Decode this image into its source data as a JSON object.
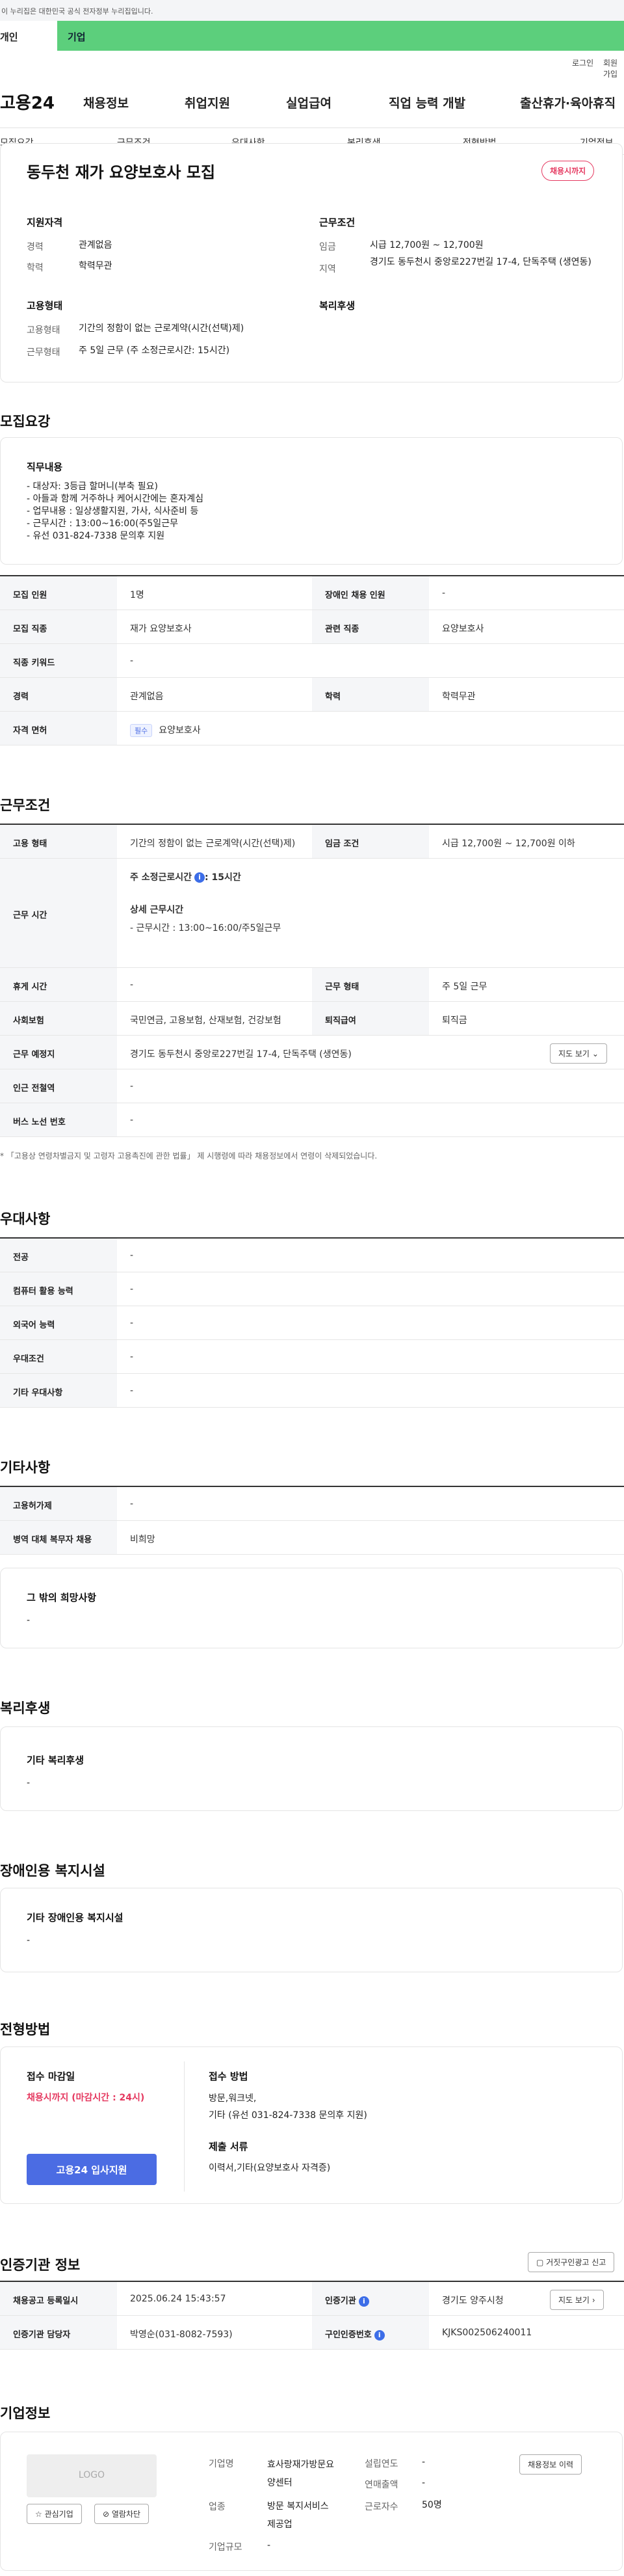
{
  "gov_notice": "이 누리집은 대한민국 공식 전자정부 누리집입니다.",
  "tabs": {
    "person": "개인",
    "company": "기업"
  },
  "util": {
    "login": "로그인",
    "join": "회원가입"
  },
  "gnb": {
    "logo": "고용24",
    "items": [
      "채용정보",
      "취업지원",
      "실업급여",
      "직업 능력 개발",
      "출산휴가·육아휴직"
    ]
  },
  "subnav": [
    "모집요강",
    "근무조건",
    "우대사항",
    "복리후생",
    "전형방법",
    "기업정보"
  ],
  "summary": {
    "title": "동두천 재가 요양보호사 모집",
    "badge": "채용시까지",
    "qual_heading": "지원자격",
    "career_label": "경력",
    "career_value": "관계없음",
    "edu_label": "학력",
    "edu_value": "학력무관",
    "work_heading": "근무조건",
    "wage_label": "임금",
    "wage_value": "시급 12,700원 ~ 12,700원",
    "region_label": "지역",
    "region_value": "경기도 동두천시 중앙로227번길 17-4, 단독주택 (생연동)",
    "emp_heading": "고용형태",
    "emp_type_label": "고용형태",
    "emp_type_value": "기간의 정함이 없는 근로계약(시간(선택)제)",
    "emp_form_label": "근무형태",
    "emp_form_value": "주 5일 근무 (주 소정근로시간: 15시간)",
    "welfare_heading": "복리후생"
  },
  "recruit": {
    "section_title": "모집요강",
    "duty_heading": "직무내용",
    "duty_text": "- 대상자: 3등급 할머니(부축 필요)\n- 아들과 함께 거주하나 케어시간에는 혼자계심\n- 업무내용 : 일상생활지원, 가사, 식사준비 등\n- 근무시간 : 13:00~16:00(주5일근무\n- 유선 031-824-7338 문의후 지원",
    "rows": [
      {
        "l1": "모집 인원",
        "v1": "1명",
        "l2": "장애인 채용 인원",
        "v2": "-"
      },
      {
        "l1": "모집 직종",
        "v1": "재가 요양보호사",
        "l2": "관련 직종",
        "v2": "요양보호사"
      },
      {
        "l1": "직종 키워드",
        "v1": "-",
        "l2": "",
        "v2": ""
      },
      {
        "l1": "경력",
        "v1": "관계없음",
        "l2": "학력",
        "v2": "학력무관"
      }
    ],
    "license_label": "자격 면허",
    "license_pill": "필수",
    "license_value": "요양보호사"
  },
  "work": {
    "section_title": "근무조건",
    "emp_label": "고용 형태",
    "emp_value": "기간의 정함이 없는 근로계약(시간(선택)제)",
    "wage_label": "임금 조건",
    "wage_value": "시급 12,700원 ~ 12,700원 이하",
    "hours_label": "근무 시간",
    "hours_main": "주 소정근로시간",
    "hours_main_value": ": 15시간",
    "hours_detail_title": "상세 근무시간",
    "hours_detail": "- 근무시간 : 13:00~16:00/주5일근무",
    "rest_label": "휴게 시간",
    "rest_value": "-",
    "form_label": "근무 형태",
    "form_value": "주 5일 근무",
    "ins_label": "사회보험",
    "ins_value": "국민연금, 고용보험, 산재보험, 건강보험",
    "sev_label": "퇴직급여",
    "sev_value": "퇴직금",
    "place_label": "근무 예정지",
    "place_value": "경기도 동두천시 중앙로227번길 17-4, 단독주택 (생연동)",
    "map_button": "지도 보기",
    "subway_label": "인근 전철역",
    "subway_value": "-",
    "bus_label": "버스 노선 번호",
    "bus_value": "-",
    "notice": "* 「고용상 연령차별금지 및 고령자 고용촉진에 관한 법률」 제 시행령에 따라 채용정보에서 연령이 삭제되었습니다."
  },
  "pref": {
    "section_title": "우대사항",
    "rows": [
      {
        "label": "전공",
        "value": "-"
      },
      {
        "label": "컴퓨터 활용 능력",
        "value": "-"
      },
      {
        "label": "외국어 능력",
        "value": "-"
      },
      {
        "label": "우대조건",
        "value": "-"
      },
      {
        "label": "기타 우대사항",
        "value": "-"
      }
    ]
  },
  "etc": {
    "section_title": "기타사항",
    "rows": [
      {
        "label": "고용허가제",
        "value": "-"
      },
      {
        "label": "병역 대체 복무자 채용",
        "value": "비희망"
      }
    ],
    "extra_heading": "그 밖의 희망사항",
    "extra_value": "-"
  },
  "welfare": {
    "section_title": "복리후생",
    "heading": "기타 복리후생",
    "value": "-"
  },
  "disability": {
    "section_title": "장애인용 복지시설",
    "heading": "기타 장애인용 복지시설",
    "value": "-"
  },
  "apply": {
    "section_title": "전형방법",
    "deadline_heading": "접수 마감일",
    "deadline_value": "채용시까지 (마감시간 : 24시)",
    "apply_button": "고용24 입사지원",
    "method_heading": "접수 방법",
    "method_value": "방문,워크넷,\n기타 (유선 031-824-7338 문의후 지원)",
    "docs_heading": "제출 서류",
    "docs_value": "이력서,기타(요양보호사 자격증)"
  },
  "agency": {
    "section_title": "인증기관 정보",
    "report_button": "거짓구인광고 신고",
    "reg_label": "채용공고 등록일시",
    "reg_value": "2025.06.24 15:43:57",
    "org_label": "인증기관",
    "org_value": "경기도 양주시청",
    "map_button": "지도 보기",
    "mgr_label": "인증기관 담당자",
    "mgr_value": "박영순(031-8082-7593)",
    "no_label": "구인인증번호",
    "no_value": "KJKS002506240011"
  },
  "company": {
    "section_title": "기업정보",
    "logo_placeholder": "LOGO",
    "fav_button": "관심기업",
    "block_button": "열람차단",
    "name_label": "기업명",
    "name_value": "효사랑재가방문요\n양센터",
    "industry_label": "업종",
    "industry_value": "방문 복지서비스\n제공업",
    "size_label": "기업규모",
    "size_value": "-",
    "year_label": "설립연도",
    "year_value": "-",
    "sales_label": "연매출액",
    "sales_value": "-",
    "staff_label": "근로자수",
    "staff_value": "50명",
    "detail_button": "채용정보 이력"
  }
}
